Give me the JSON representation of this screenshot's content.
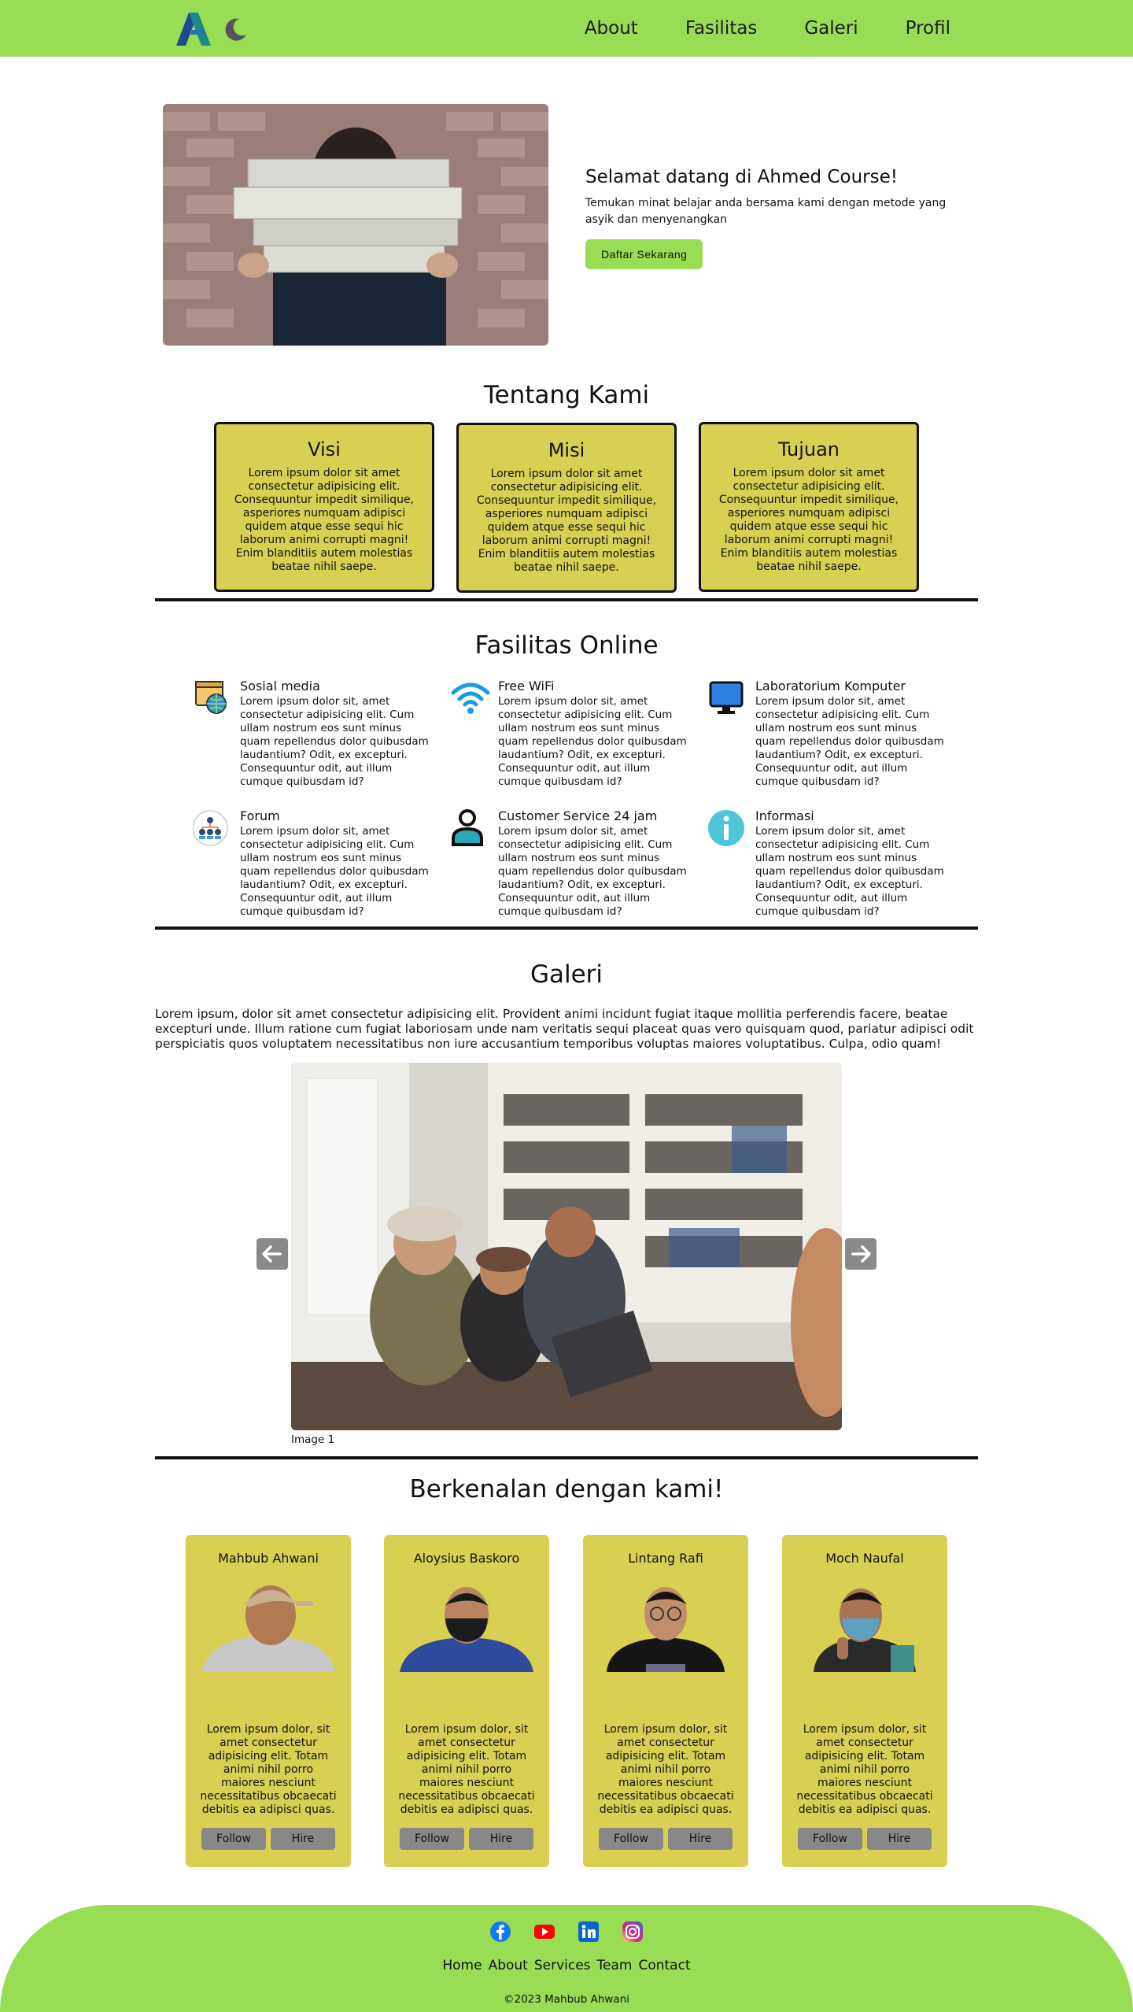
{
  "nav": {
    "logo_icon": "ahmed-course-logo",
    "theme_icon": "moon-icon",
    "links": [
      "About",
      "Fasilitas",
      "Galeri",
      "Profil"
    ]
  },
  "hero": {
    "title": "Selamat datang di Ahmed Course!",
    "text": "Temukan minat belajar anda bersama kami dengan metode yang asyik dan menyenangkan",
    "button": "Daftar Sekarang"
  },
  "about": {
    "title": "Tentang Kami",
    "cards": [
      {
        "title": "Visi",
        "text": "Lorem ipsum dolor sit amet consectetur adipisicing elit. Consequuntur impedit similique, asperiores numquam adipisci quidem atque esse sequi hic laborum animi corrupti magni! Enim blanditiis autem molestias beatae nihil saepe."
      },
      {
        "title": "Misi",
        "text": "Lorem ipsum dolor sit amet consectetur adipisicing elit. Consequuntur impedit similique, asperiores numquam adipisci quidem atque esse sequi hic laborum animi corrupti magni! Enim blanditiis autem molestias beatae nihil saepe."
      },
      {
        "title": "Tujuan",
        "text": "Lorem ipsum dolor sit amet consectetur adipisicing elit. Consequuntur impedit similique, asperiores numquam adipisci quidem atque esse sequi hic laborum animi corrupti magni! Enim blanditiis autem molestias beatae nihil saepe."
      }
    ]
  },
  "facilities": {
    "title": "Fasilitas Online",
    "items": [
      {
        "title": "Sosial media",
        "icon": "globe-browser-icon",
        "text": "Lorem ipsum dolor sit, amet consectetur adipisicing elit. Cum ullam nostrum eos sunt minus quam repellendus dolor quibusdam laudantium? Odit, ex excepturi. Consequuntur odit, aut illum cumque quibusdam id?"
      },
      {
        "title": "Free WiFi",
        "icon": "wifi-icon",
        "text": "Lorem ipsum dolor sit, amet consectetur adipisicing elit. Cum ullam nostrum eos sunt minus quam repellendus dolor quibusdam laudantium? Odit, ex excepturi. Consequuntur odit, aut illum cumque quibusdam id?"
      },
      {
        "title": "Laboratorium Komputer",
        "icon": "monitor-icon",
        "text": "Lorem ipsum dolor sit, amet consectetur adipisicing elit. Cum ullam nostrum eos sunt minus quam repellendus dolor quibusdam laudantium? Odit, ex excepturi. Consequuntur odit, aut illum cumque quibusdam id?"
      },
      {
        "title": "Forum",
        "icon": "group-hierarchy-icon",
        "text": "Lorem ipsum dolor sit, amet consectetur adipisicing elit. Cum ullam nostrum eos sunt minus quam repellendus dolor quibusdam laudantium? Odit, ex excepturi. Consequuntur odit, aut illum cumque quibusdam id?"
      },
      {
        "title": "Customer Service 24 jam",
        "icon": "user-icon",
        "text": "Lorem ipsum dolor sit, amet consectetur adipisicing elit. Cum ullam nostrum eos sunt minus quam repellendus dolor quibusdam laudantium? Odit, ex excepturi. Consequuntur odit, aut illum cumque quibusdam id?"
      },
      {
        "title": "Informasi",
        "icon": "info-icon",
        "text": "Lorem ipsum dolor sit, amet consectetur adipisicing elit. Cum ullam nostrum eos sunt minus quam repellendus dolor quibusdam laudantium? Odit, ex excepturi. Consequuntur odit, aut illum cumque quibusdam id?"
      }
    ]
  },
  "gallery": {
    "title": "Galeri",
    "text": "Lorem ipsum, dolor sit amet consectetur adipisicing elit. Provident animi incidunt fugiat itaque mollitia perferendis facere, beatae excepturi unde. Illum ratione cum fugiat laboriosam unde nam veritatis sequi placeat quas vero quisquam quod, pariatur adipisci odit perspiciatis quos voluptatem necessitatibus non iure accusantium temporibus voluptas maiores voluptatibus. Culpa, odio quam!",
    "caption": "Image 1"
  },
  "team": {
    "title": "Berkenalan dengan kami!",
    "members": [
      {
        "name": "Mahbub Ahwani",
        "text": "Lorem ipsum dolor, sit amet consectetur adipisicing elit. Totam animi nihil porro maiores nesciunt necessitatibus obcaecati debitis ea adipisci quas."
      },
      {
        "name": "Aloysius Baskoro",
        "text": "Lorem ipsum dolor, sit amet consectetur adipisicing elit. Totam animi nihil porro maiores nesciunt necessitatibus obcaecati debitis ea adipisci quas."
      },
      {
        "name": "Lintang Rafi",
        "text": "Lorem ipsum dolor, sit amet consectetur adipisicing elit. Totam animi nihil porro maiores nesciunt necessitatibus obcaecati debitis ea adipisci quas."
      },
      {
        "name": "Moch Naufal",
        "text": "Lorem ipsum dolor, sit amet consectetur adipisicing elit. Totam animi nihil porro maiores nesciunt necessitatibus obcaecati debitis ea adipisci quas."
      }
    ],
    "follow_label": "Follow",
    "hire_label": "Hire"
  },
  "footer": {
    "socials": [
      "facebook-icon",
      "youtube-icon",
      "linkedin-icon",
      "instagram-icon"
    ],
    "links": [
      "Home",
      "About",
      "Services",
      "Team",
      "Contact"
    ],
    "copyright": "©2023 Mahbub Ahwani"
  },
  "colors": {
    "accent_green": "#99dd55",
    "card_yellow": "#d9cf52",
    "button_gray": "#888888",
    "divider": "#111111"
  }
}
